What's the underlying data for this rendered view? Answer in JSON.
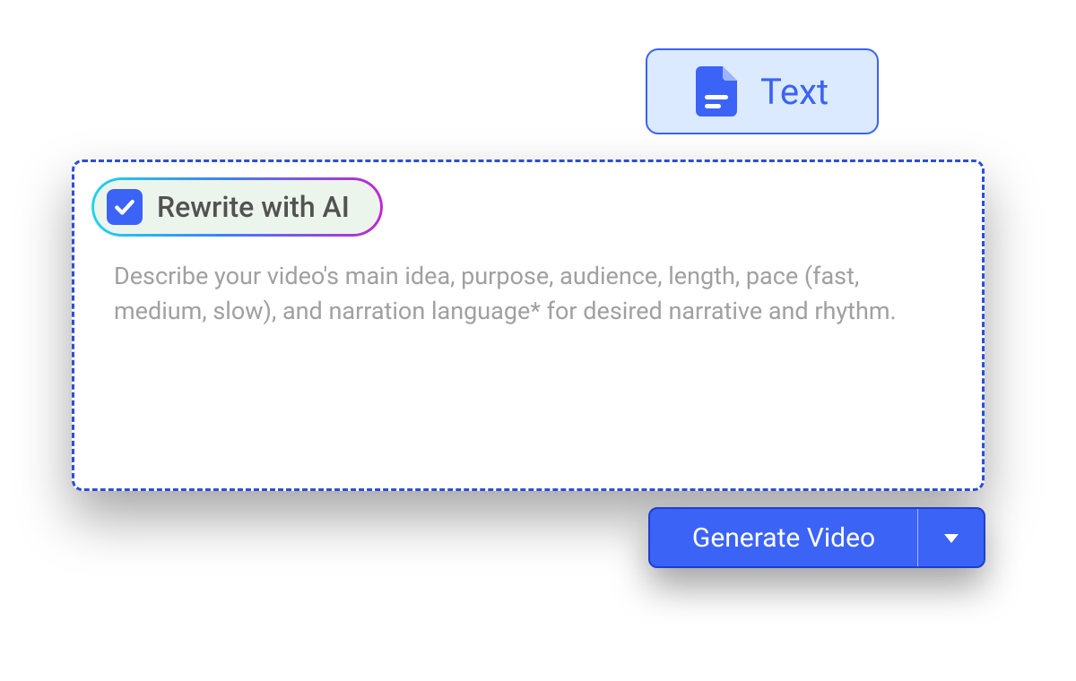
{
  "tab": {
    "label": "Text"
  },
  "rewrite": {
    "label": "Rewrite with AI",
    "checked": true
  },
  "prompt": {
    "placeholder": "Describe your video's main idea, purpose, audience, length, pace (fast, medium, slow), and narration language* for desired narrative and rhythm."
  },
  "generate": {
    "label": "Generate Video"
  },
  "colors": {
    "primary": "#3b63f6",
    "tab_bg": "#dbeafe",
    "pill_bg": "#ecf5ec",
    "placeholder": "#a0a0a0"
  }
}
